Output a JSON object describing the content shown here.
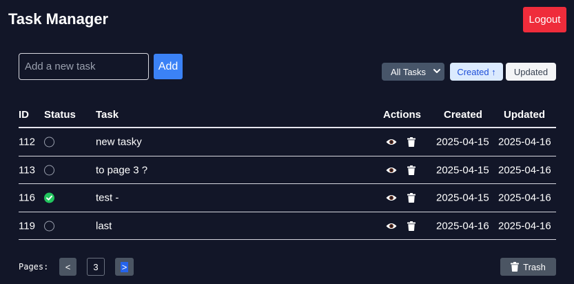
{
  "app": {
    "title": "Task Manager",
    "logout_label": "Logout"
  },
  "add_task": {
    "placeholder": "Add a new task",
    "value": "",
    "add_label": "Add"
  },
  "filter": {
    "selected": "All Tasks"
  },
  "sort": {
    "created_label": "Created ↑",
    "updated_label": "Updated",
    "active": "created"
  },
  "table": {
    "headers": {
      "id": "ID",
      "status": "Status",
      "task": "Task",
      "actions": "Actions",
      "created": "Created",
      "updated": "Updated"
    },
    "rows": [
      {
        "id": "112",
        "done": false,
        "task": "new tasky",
        "created": "2025-04-15",
        "updated": "2025-04-16"
      },
      {
        "id": "113",
        "done": false,
        "task": "to page 3 ?",
        "created": "2025-04-15",
        "updated": "2025-04-16"
      },
      {
        "id": "116",
        "done": true,
        "task": "test -",
        "created": "2025-04-15",
        "updated": "2025-04-16"
      },
      {
        "id": "119",
        "done": false,
        "task": "last",
        "created": "2025-04-16",
        "updated": "2025-04-16"
      }
    ]
  },
  "pagination": {
    "label": "Pages:",
    "prev": "<",
    "current": "3",
    "next": ">"
  },
  "trash": {
    "label": "Trash"
  },
  "colors": {
    "background": "#121628",
    "accent": "#3b82f6",
    "danger": "#ef2c3b",
    "done": "#22c55e"
  }
}
